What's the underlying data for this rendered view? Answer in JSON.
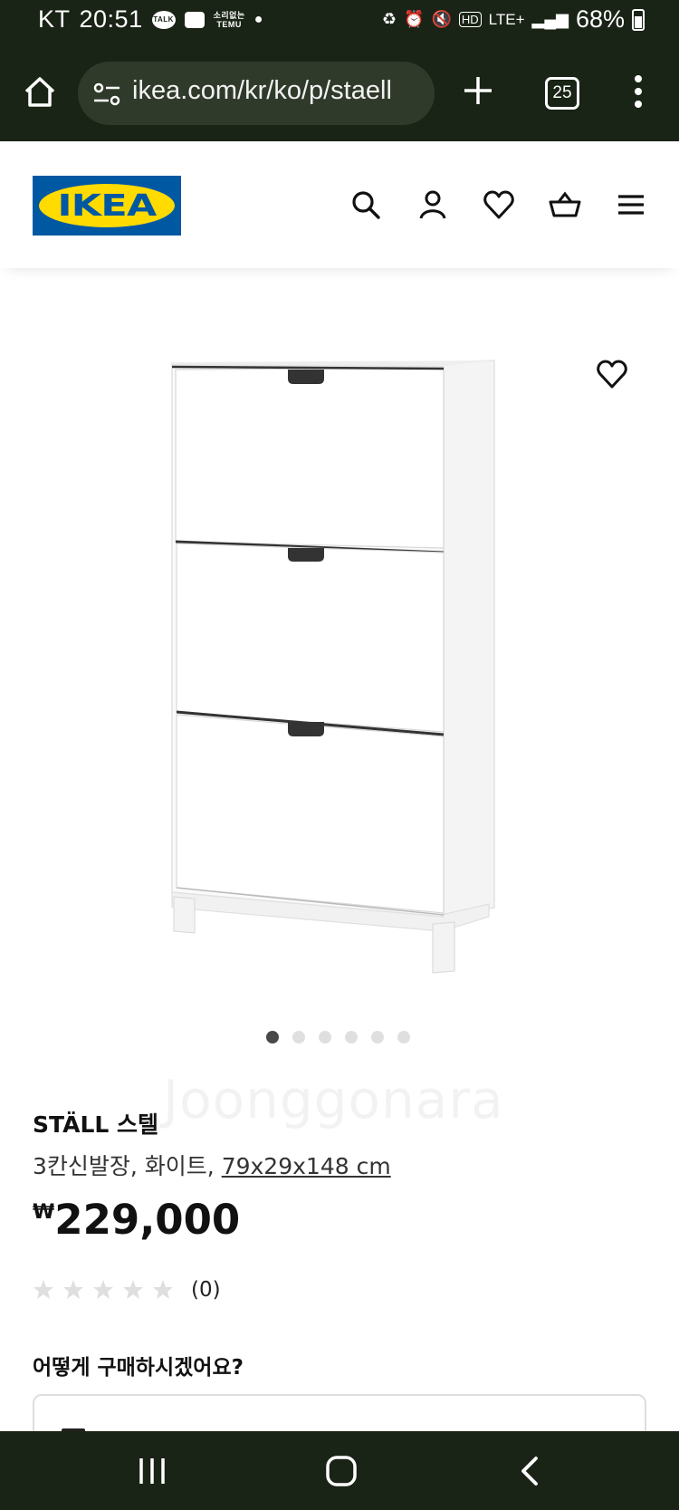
{
  "status_bar": {
    "carrier": "KT",
    "time": "20:51",
    "talk_badge": "TALK",
    "temu_line1": "소리없는",
    "temu_line2": "TEMU",
    "network": "LTE+",
    "battery": "68%",
    "hd_badge": "HD"
  },
  "browser": {
    "url": "ikea.com/kr/ko/p/staell",
    "tab_count": "25"
  },
  "header": {
    "logo_text": "IKEA",
    "icons": [
      "search-icon",
      "account-icon",
      "wishlist-icon",
      "cart-icon",
      "menu-icon"
    ]
  },
  "gallery": {
    "image_count": 6,
    "active_index": 0,
    "watermark": "Joonggonara"
  },
  "product": {
    "name": "STÄLL 스텔",
    "description": "3칸신발장, 화이트,",
    "size": "79x29x148 cm",
    "currency": "₩",
    "price": "229,000",
    "rating_stars": 0,
    "rating_max": 5,
    "review_count": "(0)",
    "purchase_question": "어떻게 구매하시겠어요?"
  },
  "colors": {
    "ikea_blue": "#0058a3",
    "ikea_yellow": "#ffdb00",
    "system_bar": "#1a2416"
  }
}
